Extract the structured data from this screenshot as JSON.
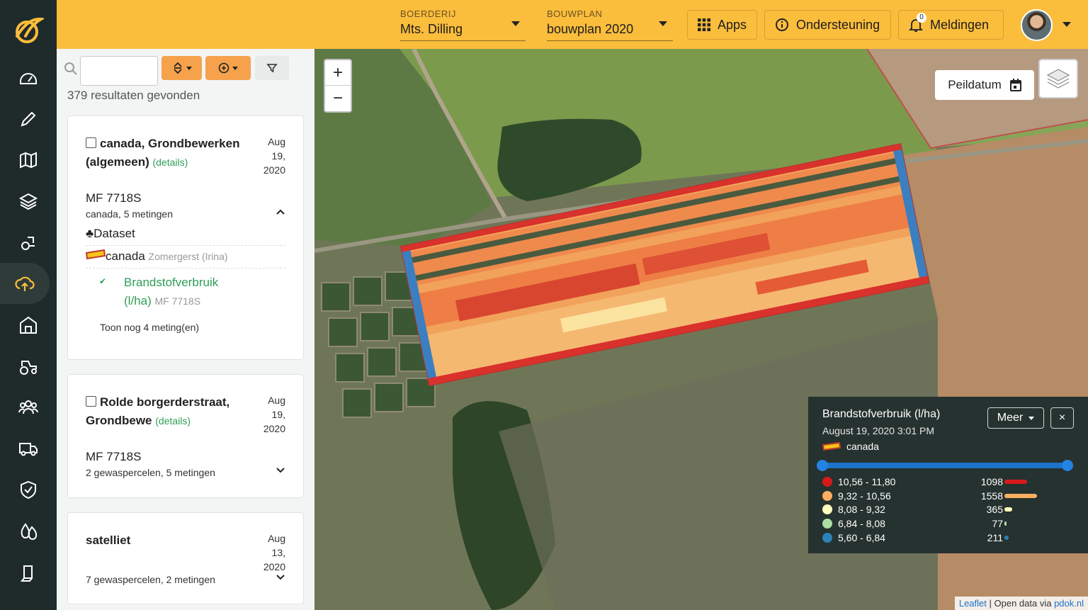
{
  "topbar": {
    "farm": {
      "label": "BOERDERIJ",
      "value": "Mts. Dilling"
    },
    "plan": {
      "label": "BOUWPLAN",
      "value": "bouwplan 2020"
    },
    "apps_label": "Apps",
    "support_label": "Ondersteuning",
    "notifications_label": "Meldingen",
    "notifications_count": "0"
  },
  "nav": {
    "icons": [
      "dashboard-icon",
      "pencil-icon",
      "map-icon",
      "layers-icon",
      "tractor-route-icon",
      "cloud-upload-icon",
      "barn-icon",
      "tractor-icon",
      "people-icon",
      "truck-icon",
      "shield-check-icon",
      "drops-icon",
      "document-icon"
    ],
    "active": "cloud-upload-icon"
  },
  "sidebar": {
    "search_value": "",
    "results_text": "379 resultaten gevonden",
    "cards": [
      {
        "title": "canada, Grondbewerken (algemeen)",
        "details": "(details)",
        "date": [
          "Aug",
          "19,",
          "2020"
        ],
        "machine": "MF 7718S",
        "meta": "canada, 5 metingen",
        "expanded": true,
        "dataset_label": "Dataset",
        "crop_name": "canada",
        "crop_variety": "Zomergerst (Irina)",
        "measurement_title_1": "Brandstofverbruik",
        "measurement_title_2": "(l/ha)",
        "measurement_machine": "MF 7718S",
        "more_label": "Toon nog 4 meting(en)"
      },
      {
        "title": "Rolde borgerderstraat, Grondbewe",
        "details": "(details)",
        "date": [
          "Aug",
          "19,",
          "2020"
        ],
        "machine": "MF 7718S",
        "meta": "2 gewaspercelen, 5 metingen",
        "expanded": false
      },
      {
        "title": "satelliet",
        "date": [
          "Aug",
          "13,",
          "2020"
        ],
        "meta": "7 gewaspercelen, 2 metingen",
        "expanded": false
      }
    ]
  },
  "map": {
    "zoom_in": "+",
    "zoom_out": "−",
    "peildatum_label": "Peildatum",
    "legend": {
      "title": "Brandstofverbruik (l/ha)",
      "date": "August 19, 2020 3:01 PM",
      "crop": "canada",
      "more_label": "Meer",
      "close_label": "×",
      "slider": [
        0,
        1
      ],
      "classes": [
        {
          "range": "10,56 - 11,80",
          "count": "1098",
          "color": "#d7191c",
          "share": 0.298
        },
        {
          "range": "9,32 - 10,56",
          "count": "1558",
          "color": "#fdae61",
          "share": 0.423
        },
        {
          "range": "8,08 - 9,32",
          "count": "365",
          "color": "#ffffbf",
          "share": 0.099
        },
        {
          "range": "6,84 - 8,08",
          "count": "77",
          "color": "#abdda4",
          "share": 0.021
        },
        {
          "range": "5,60 - 6,84",
          "count": "211",
          "color": "#2b83ba",
          "share": 0.057
        }
      ]
    },
    "attribution": {
      "leaflet": "Leaflet",
      "text": "Open data via",
      "source": "pdok.nl"
    }
  }
}
